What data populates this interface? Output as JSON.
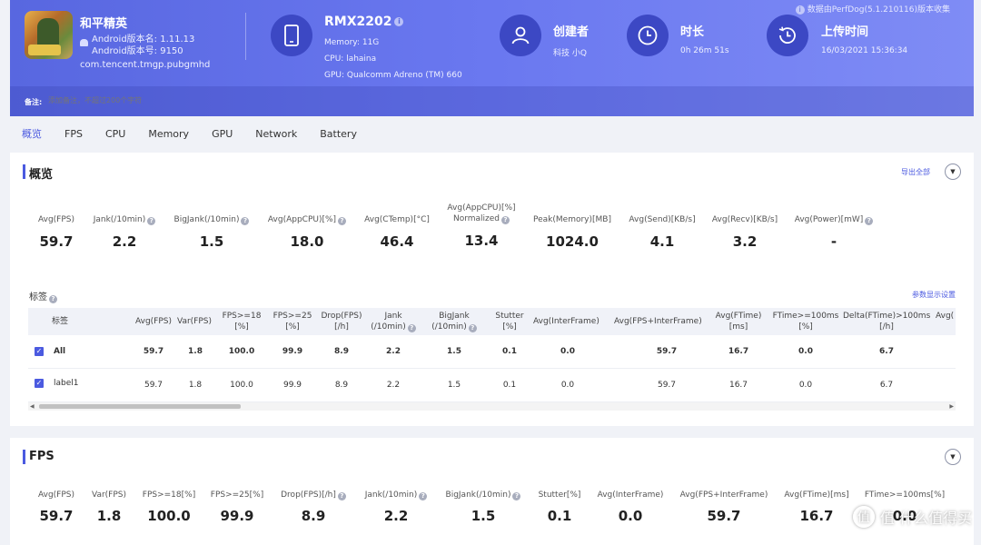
{
  "header": {
    "app": {
      "name": "和平精英",
      "version_name": "Android版本名: 1.11.13",
      "version_code": "Android版本号: 9150",
      "package": "com.tencent.tmgp.pubgmhd"
    },
    "device": {
      "model": "RMX2202",
      "memory": "Memory: 11G",
      "cpu": "CPU: lahaina",
      "gpu": "GPU: Qualcomm Adreno (TM) 660"
    },
    "creator": {
      "title": "创建者",
      "value": "科技 小Q"
    },
    "duration": {
      "title": "时长",
      "value": "0h 26m 51s"
    },
    "upload": {
      "title": "上传时间",
      "value": "16/03/2021 15:36:34"
    },
    "collected_by": "数据由PerfDog(5.1.210116)版本收集",
    "note_label": "备注:",
    "note_placeholder": "添加备注，不超过200个字符"
  },
  "tabs": [
    "概览",
    "FPS",
    "CPU",
    "Memory",
    "GPU",
    "Network",
    "Battery"
  ],
  "overview": {
    "title": "概览",
    "export": "导出全部",
    "metrics": [
      {
        "label": "Avg(FPS)",
        "value": "59.7"
      },
      {
        "label": "Jank(/10min)",
        "value": "2.2"
      },
      {
        "label": "BigJank(/10min)",
        "value": "1.5"
      },
      {
        "label": "Avg(AppCPU)[%]",
        "value": "18.0"
      },
      {
        "label": "Avg(CTemp)[°C]",
        "value": "46.4"
      },
      {
        "label": "Avg(AppCPU)[%] Normalized",
        "value": "13.4"
      },
      {
        "label": "Peak(Memory)[MB]",
        "value": "1024.0"
      },
      {
        "label": "Avg(Send)[KB/s]",
        "value": "4.1"
      },
      {
        "label": "Avg(Recv)[KB/s]",
        "value": "3.2"
      },
      {
        "label": "Avg(Power)[mW]",
        "value": "-"
      }
    ],
    "tags_title": "标签",
    "param_settings": "参数显示设置",
    "table": {
      "headers": [
        "标签",
        "Avg(FPS)",
        "Var(FPS)",
        "FPS>=18 [%]",
        "FPS>=25 [%]",
        "Drop(FPS) [/h]",
        "Jank (/10min)",
        "BigJank (/10min)",
        "Stutter [%]",
        "Avg(InterFrame)",
        "Avg(FPS+InterFrame)",
        "Avg(FTime) [ms]",
        "FTime>=100ms [%]",
        "Delta(FTime)>100ms [/h]",
        "Avg("
      ],
      "rows": [
        {
          "label": "All",
          "values": [
            "59.7",
            "1.8",
            "100.0",
            "99.9",
            "8.9",
            "2.2",
            "1.5",
            "0.1",
            "0.0",
            "59.7",
            "16.7",
            "0.0",
            "6.7"
          ]
        },
        {
          "label": "label1",
          "values": [
            "59.7",
            "1.8",
            "100.0",
            "99.9",
            "8.9",
            "2.2",
            "1.5",
            "0.1",
            "0.0",
            "59.7",
            "16.7",
            "0.0",
            "6.7"
          ]
        }
      ]
    }
  },
  "fps": {
    "title": "FPS",
    "metrics": [
      {
        "label": "Avg(FPS)",
        "value": "59.7"
      },
      {
        "label": "Var(FPS)",
        "value": "1.8"
      },
      {
        "label": "FPS>=18[%]",
        "value": "100.0"
      },
      {
        "label": "FPS>=25[%]",
        "value": "99.9"
      },
      {
        "label": "Drop(FPS)[/h]",
        "value": "8.9"
      },
      {
        "label": "Jank(/10min)",
        "value": "2.2"
      },
      {
        "label": "BigJank(/10min)",
        "value": "1.5"
      },
      {
        "label": "Stutter[%]",
        "value": "0.1"
      },
      {
        "label": "Avg(InterFrame)",
        "value": "0.0"
      },
      {
        "label": "Avg(FPS+InterFrame)",
        "value": "59.7"
      },
      {
        "label": "Avg(FTime)[ms]",
        "value": "16.7"
      },
      {
        "label": "FTime>=100ms[%]",
        "value": "0.0"
      }
    ]
  },
  "watermark": "值 什么值得买"
}
